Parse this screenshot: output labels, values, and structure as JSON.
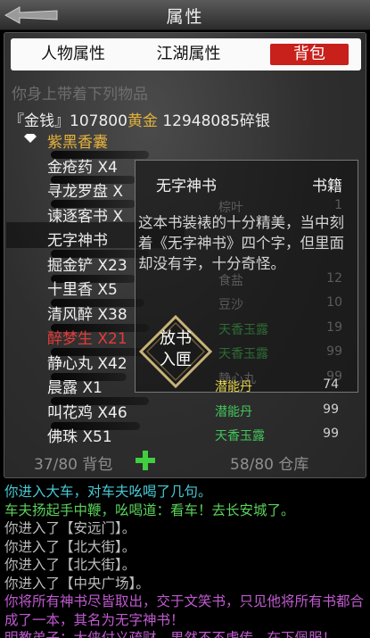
{
  "header": {
    "title": "属性"
  },
  "tabs": [
    {
      "label": "人物属性"
    },
    {
      "label": "江湖属性"
    },
    {
      "label": "背包"
    }
  ],
  "inventory": {
    "hint": "你身上带着下列物品",
    "money_label": "『金钱』",
    "money_value": "107800",
    "gold_label": "黄金",
    "gold_value": "12948085碎银",
    "items": [
      {
        "text": "紫黑香囊"
      },
      {
        "text": "金疮药 X4"
      },
      {
        "text": "寻龙罗盘 X"
      },
      {
        "text": "谏逐客书 X"
      },
      {
        "text": "无字神书"
      },
      {
        "text": "掘金铲 X23"
      },
      {
        "text": "十里香 X5"
      },
      {
        "text": "清风醉 X38"
      },
      {
        "text": "醉梦生 X21"
      },
      {
        "text": "静心丸 X42"
      },
      {
        "text": "晨露 X1"
      },
      {
        "text": "叫花鸡 X46"
      },
      {
        "text": "佛珠 X51"
      }
    ],
    "bag_count": "37/80 背包",
    "warehouse_count": "58/80 仓库"
  },
  "tooltip": {
    "name": "无字神书",
    "type": "书籍",
    "description": "这本书装裱的十分精美，当中刻着《无字神书》四个字，但里面却没有字，十分奇怪。",
    "store_button": "放书入匣",
    "background_list": [
      {
        "name": "棕叶",
        "qty": "1"
      },
      {
        "name": "食盐",
        "qty": "12"
      },
      {
        "name": "豆沙",
        "qty": "10"
      },
      {
        "name": "天香玉露",
        "qty": "19"
      },
      {
        "name": "天香玉露",
        "qty": "99"
      },
      {
        "name": "静心丸",
        "qty": "99"
      },
      {
        "name": "潜能丹",
        "qty": "74"
      },
      {
        "name": "潜能丹",
        "qty": "99"
      },
      {
        "name": "天香玉露",
        "qty": "99"
      }
    ]
  },
  "log": [
    {
      "text": "你进入大车，对车夫吆喝了几句。"
    },
    {
      "text": "车夫扬起手中鞭，吆喝道：看车！去长安城了。"
    },
    {
      "text": "你进入了【安远门】。"
    },
    {
      "text": "你进入了【北大街】。"
    },
    {
      "text": "你进入了【北大街】。"
    },
    {
      "text": "你进入了【中央广场】。"
    },
    {
      "text": "你将所有神书尽皆取出，交于文笑书，只见他将所有书都合成了一本，其名为无字神书！"
    },
    {
      "text": "明教弟子：大侠付义疏财，男然不不虚传，在下佩服！"
    }
  ],
  "colors": {
    "active_tab": "#c8201b",
    "gold": "#e2b13a",
    "log_cyan": "#47c9d4",
    "log_green": "#5ad15a"
  }
}
